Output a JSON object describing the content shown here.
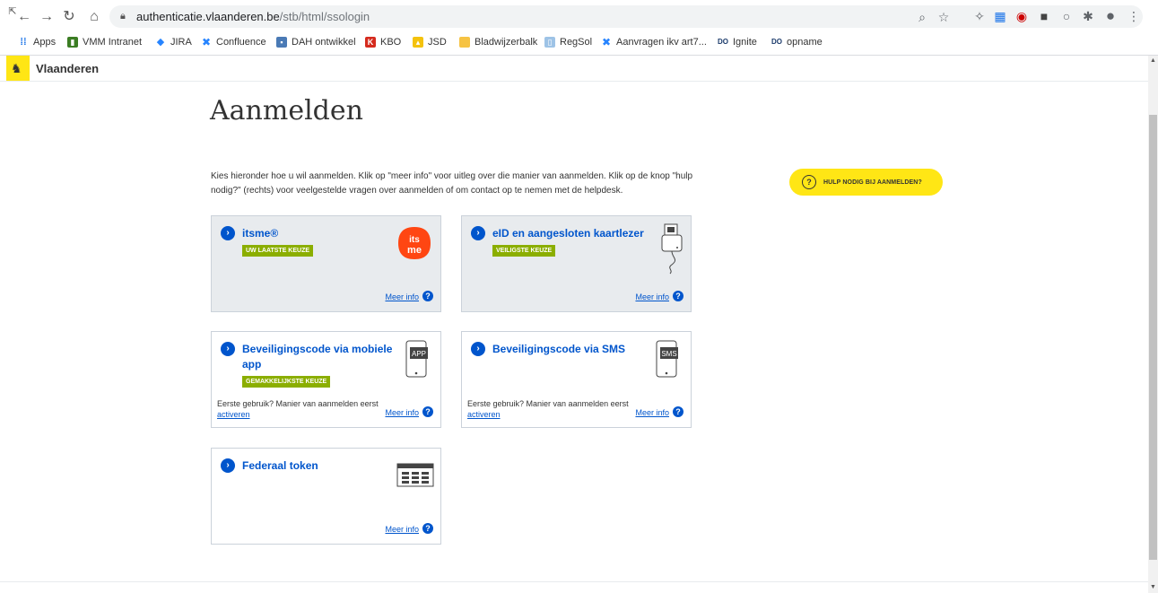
{
  "browser": {
    "url_host": "authenticatie.vlaanderen.be",
    "url_path": "/stb/html/ssologin",
    "bookmarks": [
      "Apps",
      "VMM Intranet",
      "JIRA",
      "Confluence",
      "DAH ontwikkel",
      "KBO",
      "JSD",
      "Bladwijzerbalk",
      "RegSol",
      "Aanvragen ikv art7...",
      "Ignite",
      "opname"
    ]
  },
  "site": {
    "title": "Vlaanderen"
  },
  "main": {
    "heading": "Aanmelden",
    "intro": "Kies hieronder hoe u wil aanmelden. Klik op \"meer info\" voor uitleg over die manier van aanmelden. Klik op de knop \"hulp nodig?\" (rechts) voor veelgestelde vragen over aanmelden of om contact op te nemen met de helpdesk.",
    "help_button": "HULP NODIG BIJ AANMELDEN?",
    "meer_info": "Meer info",
    "first_use": "Eerste gebruik? Manier van aanmelden eerst",
    "activate": "activeren",
    "options": [
      {
        "title": "itsme®",
        "badge": "UW LAATSTE KEUZE"
      },
      {
        "title": "eID en aangesloten kaartlezer",
        "badge": "VEILIGSTE KEUZE"
      },
      {
        "title": "Beveiligingscode via mobiele app",
        "badge": "GEMAKKELIJKSTE KEUZE",
        "icon_text": "APP"
      },
      {
        "title": "Beveiligingscode via SMS",
        "icon_text": "SMS"
      },
      {
        "title": "Federaal token"
      }
    ]
  },
  "colors": {
    "accent_blue": "#0055cc",
    "vlaanderen_yellow": "#ffe615",
    "badge_green": "#8bae00",
    "itsme_red": "#ff4612"
  }
}
